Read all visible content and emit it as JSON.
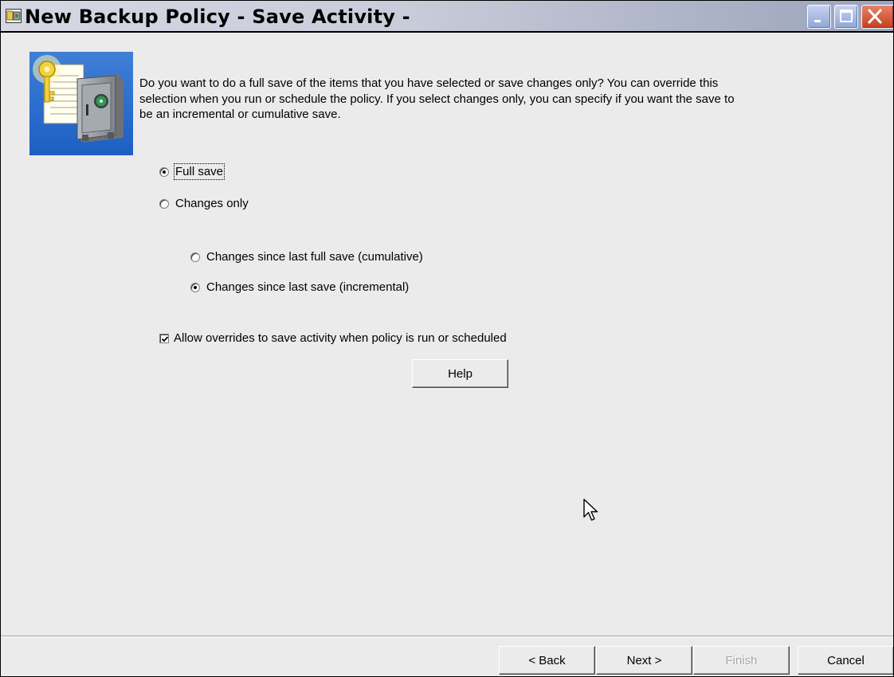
{
  "window": {
    "title": "New Backup Policy - Save Activity -"
  },
  "title_bar": {
    "app_icon": "backup-policy-app-icon",
    "buttons": {
      "minimize": "minimize-icon",
      "maximize": "maximize-icon",
      "close": "close-icon"
    }
  },
  "illustration": "safe-with-key-icon",
  "intro": {
    "line1": "Do you want to do a full save of the items that you have selected or save changes only?  You can override this",
    "line2": "selection when you run or schedule the policy.  If you select changes only, you can specify if you want the save to",
    "line3": "be an incremental or cumulative save."
  },
  "options": {
    "full_save": {
      "label": "Full save",
      "selected": true
    },
    "changes_only": {
      "label": "Changes only",
      "selected": false
    },
    "cumulative": {
      "label": "Changes since last full save (cumulative)",
      "selected": false
    },
    "incremental": {
      "label": "Changes since last save (incremental)",
      "selected": true
    }
  },
  "allow_overrides": {
    "label": "Allow overrides to save activity when policy is run or scheduled",
    "checked": true
  },
  "buttons": {
    "help": "Help",
    "back": "< Back",
    "next": "Next >",
    "finish": "Finish",
    "cancel": "Cancel"
  },
  "colors": {
    "dialog_bg": "#ebebeb",
    "title_gradient_start": "#d6d7e3",
    "title_gradient_end": "#9aa3bb",
    "close_red": "#c3401f"
  }
}
